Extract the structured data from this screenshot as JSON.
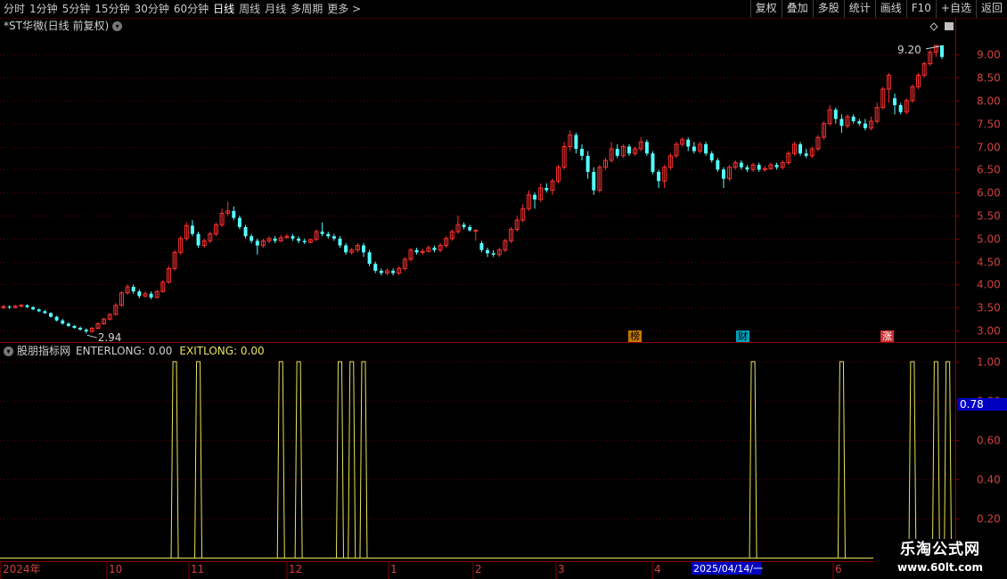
{
  "toolbar": {
    "periods": [
      "分时",
      "1分钟",
      "5分钟",
      "15分钟",
      "30分钟",
      "60分钟",
      "日线",
      "周线",
      "月线",
      "多周期",
      "更多 >"
    ],
    "active_period": "日线",
    "buttons": [
      "复权",
      "叠加",
      "多股",
      "统计",
      "画线",
      "F10",
      "+自选",
      "返回"
    ]
  },
  "main_chart": {
    "title": "*ST华微(日线 前复权)",
    "price_axis": [
      "9.00",
      "8.50",
      "8.00",
      "7.50",
      "7.00",
      "6.50",
      "6.00",
      "5.50",
      "5.00",
      "4.50",
      "4.00",
      "3.50",
      "3.00"
    ],
    "price_range": [
      2.75,
      9.45
    ],
    "high_label": "9.20",
    "low_label": "2.94",
    "tags": [
      "榜",
      "财",
      "涨"
    ],
    "candles": [
      [
        3.5,
        3.52,
        3.56,
        3.46
      ],
      [
        3.52,
        3.5,
        3.55,
        3.47
      ],
      [
        3.5,
        3.53,
        3.56,
        3.48
      ],
      [
        3.53,
        3.55,
        3.58,
        3.5
      ],
      [
        3.55,
        3.51,
        3.57,
        3.49
      ],
      [
        3.51,
        3.46,
        3.53,
        3.44
      ],
      [
        3.46,
        3.42,
        3.48,
        3.4
      ],
      [
        3.42,
        3.38,
        3.45,
        3.36
      ],
      [
        3.38,
        3.3,
        3.4,
        3.28
      ],
      [
        3.3,
        3.22,
        3.32,
        3.2
      ],
      [
        3.22,
        3.15,
        3.25,
        3.13
      ],
      [
        3.15,
        3.1,
        3.18,
        3.08
      ],
      [
        3.1,
        3.06,
        3.12,
        3.04
      ],
      [
        3.06,
        3.02,
        3.09,
        3.0
      ],
      [
        3.02,
        2.98,
        3.05,
        2.94
      ],
      [
        2.98,
        3.05,
        3.08,
        2.96
      ],
      [
        3.05,
        3.15,
        3.18,
        3.03
      ],
      [
        3.15,
        3.25,
        3.28,
        3.12
      ],
      [
        3.25,
        3.35,
        3.38,
        3.22
      ],
      [
        3.35,
        3.55,
        3.6,
        3.33
      ],
      [
        3.55,
        3.82,
        3.85,
        3.52
      ],
      [
        3.82,
        3.95,
        4.0,
        3.78
      ],
      [
        3.95,
        3.85,
        4.0,
        3.8
      ],
      [
        3.85,
        3.75,
        3.9,
        3.7
      ],
      [
        3.75,
        3.8,
        3.85,
        3.72
      ],
      [
        3.8,
        3.72,
        3.85,
        3.68
      ],
      [
        3.72,
        3.85,
        3.88,
        3.7
      ],
      [
        3.85,
        4.05,
        4.1,
        3.82
      ],
      [
        4.05,
        4.35,
        4.4,
        4.02
      ],
      [
        4.35,
        4.7,
        4.75,
        4.3
      ],
      [
        4.7,
        5.0,
        5.05,
        4.65
      ],
      [
        5.0,
        5.28,
        5.35,
        4.95
      ],
      [
        5.28,
        5.1,
        5.4,
        5.05
      ],
      [
        5.1,
        4.85,
        5.15,
        4.8
      ],
      [
        4.85,
        4.95,
        5.0,
        4.8
      ],
      [
        4.95,
        5.1,
        5.15,
        4.9
      ],
      [
        5.1,
        5.3,
        5.35,
        5.05
      ],
      [
        5.3,
        5.55,
        5.65,
        5.25
      ],
      [
        5.55,
        5.6,
        5.8,
        5.5
      ],
      [
        5.6,
        5.45,
        5.7,
        5.4
      ],
      [
        5.45,
        5.25,
        5.5,
        5.2
      ],
      [
        5.25,
        5.05,
        5.3,
        5.0
      ],
      [
        5.05,
        4.95,
        5.1,
        4.9
      ],
      [
        4.95,
        4.85,
        5.0,
        4.65
      ],
      [
        4.85,
        4.95,
        5.0,
        4.8
      ],
      [
        4.95,
        5.0,
        5.05,
        4.9
      ],
      [
        5.0,
        4.95,
        5.05,
        4.9
      ],
      [
        4.95,
        5.02,
        5.08,
        4.92
      ],
      [
        5.02,
        5.05,
        5.1,
        5.0
      ],
      [
        5.05,
        5.0,
        5.1,
        4.95
      ],
      [
        5.0,
        4.95,
        5.05,
        4.9
      ],
      [
        4.95,
        4.92,
        5.0,
        4.88
      ],
      [
        4.92,
        4.98,
        5.0,
        4.9
      ],
      [
        4.98,
        5.15,
        5.2,
        4.95
      ],
      [
        5.15,
        5.1,
        5.35,
        5.05
      ],
      [
        5.1,
        5.05,
        5.15,
        5.0
      ],
      [
        5.05,
        5.0,
        5.1,
        4.95
      ],
      [
        5.0,
        4.85,
        5.05,
        4.8
      ],
      [
        4.85,
        4.7,
        4.9,
        4.65
      ],
      [
        4.7,
        4.75,
        4.8,
        4.65
      ],
      [
        4.75,
        4.85,
        4.9,
        4.7
      ],
      [
        4.85,
        4.7,
        4.9,
        4.6
      ],
      [
        4.7,
        4.45,
        4.75,
        4.4
      ],
      [
        4.45,
        4.3,
        4.5,
        4.25
      ],
      [
        4.3,
        4.25,
        4.35,
        4.2
      ],
      [
        4.25,
        4.3,
        4.35,
        4.2
      ],
      [
        4.3,
        4.25,
        4.35,
        4.2
      ],
      [
        4.25,
        4.35,
        4.4,
        4.2
      ],
      [
        4.35,
        4.55,
        4.6,
        4.3
      ],
      [
        4.55,
        4.75,
        4.8,
        4.5
      ],
      [
        4.75,
        4.7,
        4.8,
        4.65
      ],
      [
        4.7,
        4.72,
        4.78,
        4.65
      ],
      [
        4.72,
        4.8,
        4.85,
        4.7
      ],
      [
        4.8,
        4.75,
        4.85,
        4.7
      ],
      [
        4.75,
        4.85,
        4.9,
        4.7
      ],
      [
        4.85,
        5.0,
        5.05,
        4.8
      ],
      [
        5.0,
        5.15,
        5.2,
        4.95
      ],
      [
        5.15,
        5.3,
        5.5,
        5.1
      ],
      [
        5.3,
        5.25,
        5.35,
        5.2
      ],
      [
        5.25,
        5.18,
        5.3,
        5.15
      ],
      [
        5.18,
        5.18,
        5.2,
        4.95
      ],
      [
        4.9,
        4.75,
        4.95,
        4.7
      ],
      [
        4.75,
        4.68,
        4.8,
        4.6
      ],
      [
        4.68,
        4.65,
        4.75,
        4.6
      ],
      [
        4.65,
        4.75,
        4.8,
        4.6
      ],
      [
        4.75,
        4.95,
        5.0,
        4.7
      ],
      [
        4.95,
        5.2,
        5.25,
        4.9
      ],
      [
        5.2,
        5.4,
        5.5,
        5.15
      ],
      [
        5.4,
        5.65,
        5.75,
        5.35
      ],
      [
        5.65,
        5.95,
        6.05,
        5.6
      ],
      [
        5.95,
        5.85,
        6.0,
        5.65
      ],
      [
        5.85,
        6.1,
        6.2,
        5.8
      ],
      [
        6.1,
        6.05,
        6.2,
        6.0
      ],
      [
        6.05,
        6.25,
        6.3,
        5.95
      ],
      [
        6.25,
        6.55,
        6.6,
        6.2
      ],
      [
        6.55,
        7.0,
        7.1,
        6.5
      ],
      [
        7.0,
        7.25,
        7.35,
        6.9
      ],
      [
        7.25,
        6.95,
        7.3,
        6.85
      ],
      [
        6.95,
        6.8,
        7.05,
        6.7
      ],
      [
        6.8,
        6.45,
        6.9,
        6.3
      ],
      [
        6.45,
        6.05,
        6.55,
        5.95
      ],
      [
        6.05,
        6.55,
        6.6,
        6.0
      ],
      [
        6.55,
        6.7,
        6.75,
        6.5
      ],
      [
        6.7,
        6.95,
        7.1,
        6.65
      ],
      [
        6.95,
        6.8,
        7.05,
        6.75
      ],
      [
        6.8,
        7.0,
        7.05,
        6.75
      ],
      [
        7.0,
        6.85,
        7.05,
        6.8
      ],
      [
        6.85,
        6.95,
        7.0,
        6.8
      ],
      [
        6.95,
        7.1,
        7.2,
        6.9
      ],
      [
        7.1,
        6.85,
        7.15,
        6.8
      ],
      [
        6.85,
        6.45,
        6.9,
        6.4
      ],
      [
        6.45,
        6.25,
        6.5,
        6.1
      ],
      [
        6.25,
        6.55,
        6.6,
        6.1
      ],
      [
        6.55,
        6.8,
        6.85,
        6.5
      ],
      [
        6.8,
        7.05,
        7.1,
        6.75
      ],
      [
        7.05,
        7.15,
        7.2,
        7.0
      ],
      [
        7.15,
        7.0,
        7.2,
        6.9
      ],
      [
        7.0,
        6.9,
        7.1,
        6.85
      ],
      [
        6.9,
        7.05,
        7.1,
        6.85
      ],
      [
        7.05,
        6.85,
        7.1,
        6.8
      ],
      [
        6.85,
        6.7,
        6.9,
        6.65
      ],
      [
        6.7,
        6.5,
        6.75,
        6.45
      ],
      [
        6.5,
        6.3,
        6.55,
        6.1
      ],
      [
        6.3,
        6.55,
        6.6,
        6.25
      ],
      [
        6.55,
        6.65,
        6.7,
        6.5
      ],
      [
        6.65,
        6.55,
        6.7,
        6.5
      ],
      [
        6.55,
        6.5,
        6.6,
        6.45
      ],
      [
        6.5,
        6.6,
        6.65,
        6.45
      ],
      [
        6.6,
        6.5,
        6.65,
        6.45
      ],
      [
        6.5,
        6.52,
        6.58,
        6.45
      ],
      [
        6.52,
        6.6,
        6.65,
        6.5
      ],
      [
        6.6,
        6.55,
        6.65,
        6.5
      ],
      [
        6.55,
        6.65,
        6.7,
        6.5
      ],
      [
        6.65,
        6.85,
        6.9,
        6.6
      ],
      [
        6.85,
        7.05,
        7.1,
        6.8
      ],
      [
        7.05,
        6.85,
        7.1,
        6.8
      ],
      [
        6.85,
        6.8,
        6.95,
        6.75
      ],
      [
        6.8,
        6.95,
        7.0,
        6.75
      ],
      [
        6.95,
        7.2,
        7.25,
        6.9
      ],
      [
        7.2,
        7.5,
        7.55,
        7.15
      ],
      [
        7.5,
        7.8,
        7.9,
        7.45
      ],
      [
        7.8,
        7.6,
        7.85,
        7.5
      ],
      [
        7.6,
        7.45,
        7.7,
        7.3
      ],
      [
        7.45,
        7.65,
        7.7,
        7.4
      ],
      [
        7.65,
        7.55,
        7.7,
        7.5
      ],
      [
        7.55,
        7.5,
        7.6,
        7.45
      ],
      [
        7.5,
        7.4,
        7.6,
        7.35
      ],
      [
        7.4,
        7.55,
        7.65,
        7.35
      ],
      [
        7.55,
        7.85,
        7.95,
        7.5
      ],
      [
        7.85,
        8.25,
        8.3,
        7.8
      ],
      [
        8.25,
        8.55,
        8.6,
        7.95
      ],
      [
        8.05,
        7.9,
        8.15,
        7.7
      ],
      [
        7.9,
        7.75,
        7.95,
        7.7
      ],
      [
        7.75,
        8.0,
        8.05,
        7.7
      ],
      [
        8.0,
        8.3,
        8.35,
        7.95
      ],
      [
        8.3,
        8.55,
        8.6,
        8.25
      ],
      [
        8.55,
        8.8,
        8.85,
        8.5
      ],
      [
        8.8,
        9.05,
        9.1,
        8.75
      ],
      [
        9.05,
        9.2,
        9.2,
        8.95
      ],
      [
        9.2,
        8.95,
        9.2,
        8.9
      ]
    ]
  },
  "indicator": {
    "name": "股朋指标网",
    "enter_label": "ENTERLONG: 0.00",
    "exit_label": "EXITLONG: 0.00",
    "axis": [
      "1.00",
      "0.80",
      "0.60",
      "0.40",
      "0.20"
    ],
    "current_value": "0.78",
    "spike_indices": [
      29,
      33,
      47,
      50,
      57,
      59,
      61,
      127,
      142,
      154,
      158,
      160,
      219,
      222,
      227
    ]
  },
  "time_axis": {
    "labels": [
      "2024年",
      "10",
      "11",
      "12",
      "1",
      "2",
      "3",
      "4",
      "6"
    ],
    "cursor_label": "2025/04/14/一"
  },
  "watermark": {
    "line1": "乐淘公式网",
    "line2": "www.60lt.com"
  },
  "colors": {
    "up": "#ff3232",
    "down": "#54ffff",
    "grid": "#5a0000",
    "axis_line": "#8b0000",
    "indicator": "#e8e35a",
    "accent_blue": "#0000c0"
  }
}
